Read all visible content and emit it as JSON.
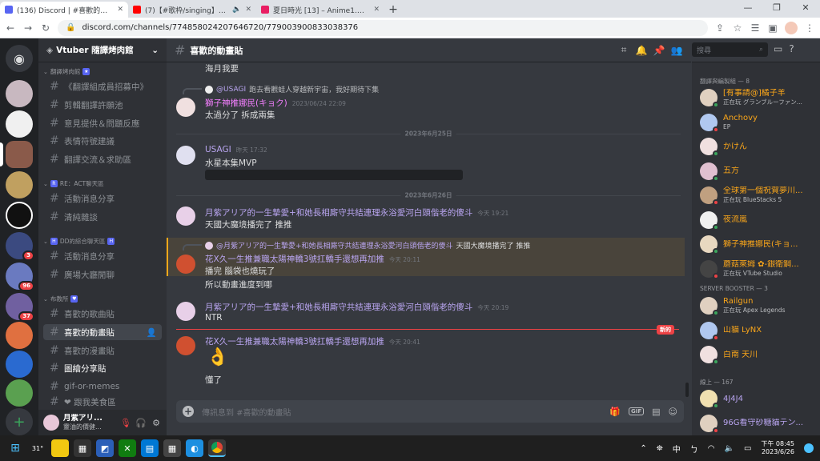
{
  "browser": {
    "tabs": [
      {
        "title": "(136) Discord | #喜歡的動畫貼 |",
        "color": "#5865f2",
        "active": true
      },
      {
        "title": "(7)【#歌枠/singing】初見大",
        "color": "#ff0000",
        "active": false
      },
      {
        "title": "夏日時光 [13] – Anime1.me 動畫",
        "color": "#e91e63",
        "active": false
      }
    ],
    "new_tab": "+",
    "url": "discord.com/channels/774858024207646720/779003900833038376",
    "controls": {
      "min": "—",
      "max": "❐",
      "close": "✕"
    }
  },
  "servers": {
    "badges": [
      "3",
      "96",
      "37"
    ]
  },
  "guild": {
    "name": "Vtuber 隨譯烤肉館",
    "chevron": "⌄"
  },
  "channels": {
    "cat1": "翻譯烤肉館",
    "cat1_badge": "★",
    "c1": "《翻譯組成員招募中》",
    "c2": "剪輯翻譯許願池",
    "c3": "意見提供＆問題反應",
    "c4": "表情符號建議",
    "c5": "翻譯交流＆求助區",
    "cat2": "RE：ACT聊天區",
    "cat2_badge": "R",
    "c6": "活動消息分享",
    "c7": "清純雜談",
    "cat3": "DD的綜合聊天區",
    "cat3_badge": "H",
    "c8": "活動消息分享",
    "c9": "廣場大廳閒聊",
    "cat4": "布教所",
    "cat4_badge": "♥",
    "c10": "喜歡的歌曲貼",
    "c11": "喜歡的動畫貼",
    "c12": "喜歡的漫畫貼",
    "c13": "圖繪分享貼",
    "c14": "gif-or-memes",
    "c15": "❤ 跟我美食區"
  },
  "user": {
    "name": "月紫アリ...",
    "status": "靈油的價健..."
  },
  "chat": {
    "channel": "喜歡的動畫貼",
    "search_placeholder": "搜尋",
    "top_text": "海月我要",
    "m1": {
      "reply_user": "@USAGI",
      "reply_text": "跑去看觀蛙人穿越新宇宙，我好期待下集",
      "author": "獅子神推娜民(キョク)",
      "time": "2023/06/24 22:09",
      "text": "太過分了 拆成兩集"
    },
    "div1": "2023年6月25日",
    "m2": {
      "author": "USAGI",
      "time": "昨天 17:32",
      "text": "水星本集MVP"
    },
    "div2": "2023年6月26日",
    "m3": {
      "author": "月紫アリア的一生摯愛+和她長相廝守共結連理永浴愛河白頭偕老的傻斗",
      "time": "今天 19:21",
      "text": "天國大魔境播完了 推推"
    },
    "m4": {
      "reply_user": "@月紫アリア的一生摯愛+和她長相廝守共結連理永浴愛河白頭偕老的傻斗",
      "reply_text": "天國大魔境播完了 推推",
      "author": "花X久一生推兼職太陽神轎3號扛轎手還想再加推",
      "time": "今天 20:11",
      "text1": "播完 腦袋也燒玩了",
      "text2": "所以動畫進度到哪"
    },
    "m5": {
      "author": "月紫アリア的一生摯愛+和她長相廝守共結連理永浴愛河白頭偕老的傻斗",
      "time": "今天 20:19",
      "text": "NTR"
    },
    "new": "新的",
    "m6": {
      "author": "花X久一生推兼職太陽神轎3號扛轎手還想再加推",
      "time": "今天 20:41",
      "text": "懂了"
    },
    "composer_placeholder": "傳訊息到 #喜歡的動畫貼",
    "gif": "GIF"
  },
  "members": {
    "g1": "翻譯與編製組 — 8",
    "list1": [
      {
        "name": "[有事請@]橘子羊",
        "status": "正在玩 グランブルーファン...",
        "color": "#faa61a"
      },
      {
        "name": "Anchovy",
        "status": "EP",
        "color": "#faa61a"
      },
      {
        "name": "かけん",
        "status": "",
        "color": "#faa61a"
      },
      {
        "name": "五方",
        "status": "",
        "color": "#faa61a"
      },
      {
        "name": "全球第一個祝賀夢川...",
        "status": "正在玩 BlueStacks 5",
        "color": "#faa61a"
      },
      {
        "name": "夜流嵐",
        "status": "",
        "color": "#faa61a"
      },
      {
        "name": "獅子神推娜民(キョ...",
        "status": "",
        "color": "#faa61a"
      },
      {
        "name": "蘑菇萊姆 ✿-銀衛鋼...",
        "status": "正在玩 VTube Studio",
        "color": "#faa61a"
      }
    ],
    "g2": "SERVER BOOSTER — 3",
    "list2": [
      {
        "name": "Railgun",
        "status": "正在玩 Apex Legends",
        "color": "#faa61a"
      },
      {
        "name": "山貓 LyNX",
        "status": "",
        "color": "#faa61a"
      },
      {
        "name": "白南 天川",
        "status": "",
        "color": "#faa61a"
      }
    ],
    "g3": "線上 — 167",
    "list3": [
      {
        "name": "4J4J4",
        "status": "",
        "color": "#b9a5f0"
      },
      {
        "name": "96G看守砂糖貓テン...",
        "status": "",
        "color": "#b9a5f0"
      }
    ]
  },
  "taskbar": {
    "temp": "31°",
    "ime": "中",
    "time": "下午 08:45",
    "date": "2023/6/26"
  }
}
